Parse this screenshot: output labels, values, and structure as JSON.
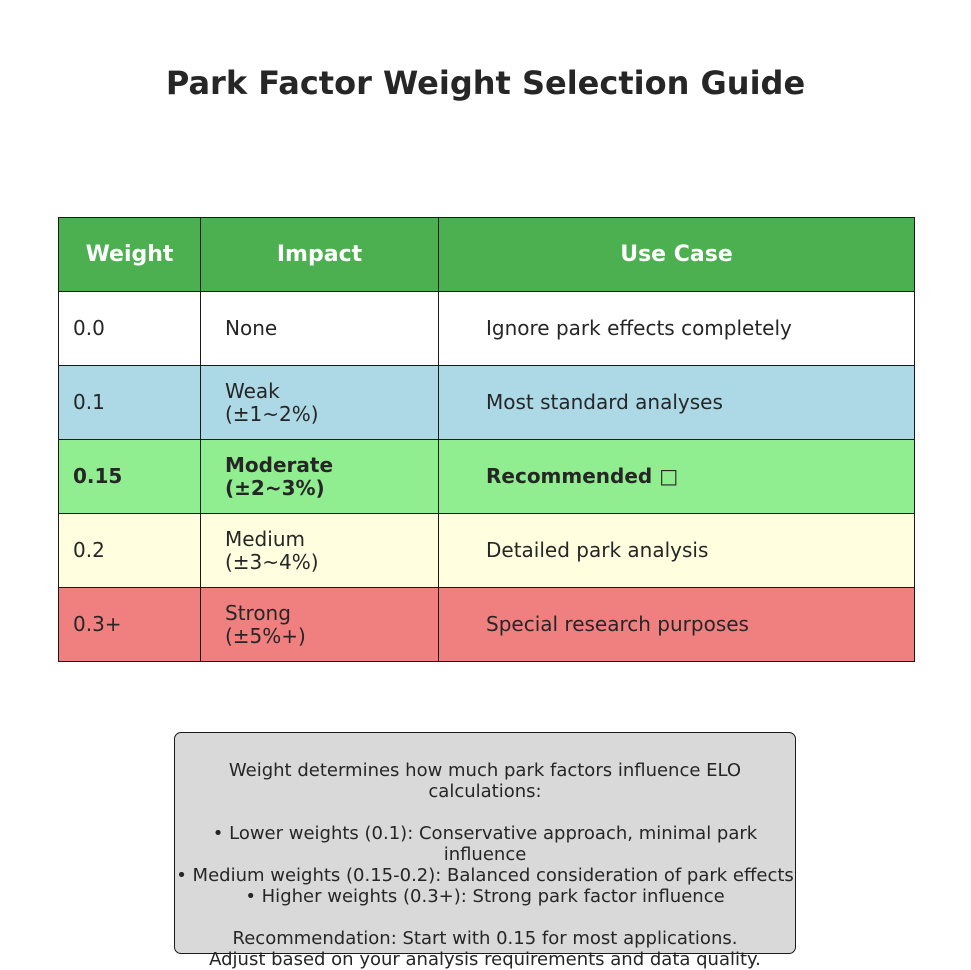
{
  "title": "Park Factor Weight Selection Guide",
  "table": {
    "headers": {
      "weight": "Weight",
      "impact": "Impact",
      "use_case": "Use Case"
    },
    "rows": [
      {
        "weight": "0.0",
        "impact_line1": "None",
        "impact_line2": "",
        "use_case": "Ignore park effects completely",
        "bg": "#ffffff"
      },
      {
        "weight": "0.1",
        "impact_line1": "Weak",
        "impact_line2": "(±1~2%)",
        "use_case": "Most standard analyses",
        "bg": "#add8e6"
      },
      {
        "weight": "0.15",
        "impact_line1": "Moderate",
        "impact_line2": "(±2~3%)",
        "use_case": "Recommended □",
        "bg": "#90ee90"
      },
      {
        "weight": "0.2",
        "impact_line1": "Medium",
        "impact_line2": "(±3~4%)",
        "use_case": "Detailed park analysis",
        "bg": "#ffffe0"
      },
      {
        "weight": "0.3+",
        "impact_line1": "Strong",
        "impact_line2": "(±5%+)",
        "use_case": "Special research purposes",
        "bg": "#f08080"
      }
    ],
    "header_bg": "#4caf50"
  },
  "notes": {
    "intro": "Weight determines how much park factors influence ELO calculations:",
    "bullets": [
      "• Lower weights (0.1): Conservative approach, minimal park influence",
      "• Medium weights (0.15-0.2): Balanced consideration of park effects",
      "• Higher weights (0.3+): Strong park factor influence"
    ],
    "recommendation": "Recommendation: Start with 0.15 for most applications.",
    "adjust": "Adjust based on your analysis requirements and data quality.",
    "bg": "#d9d9d9"
  }
}
